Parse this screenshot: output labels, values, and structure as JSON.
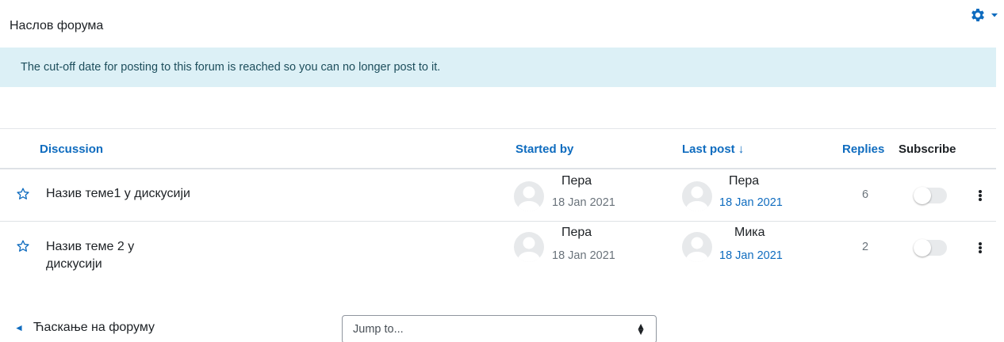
{
  "forum": {
    "title": "Наслов форума",
    "alert": "The cut-off date for posting to this forum is reached so you can no longer post to it."
  },
  "table": {
    "headers": {
      "discussion": "Discussion",
      "started_by": "Started by",
      "last_post": "Last post",
      "replies": "Replies",
      "subscribe": "Subscribe"
    },
    "sort_indicator": "↓",
    "rows": [
      {
        "topic": "Назив теме1 у дискусији",
        "started_by": "Пера",
        "started_date": "18 Jan 2021",
        "last_post_by": "Пера",
        "last_post_date": "18 Jan 2021",
        "replies": "6",
        "subscribed": false
      },
      {
        "topic": "Назив теме 2 у дискусији",
        "started_by": "Пера",
        "started_date": "18 Jan 2021",
        "last_post_by": "Мика",
        "last_post_date": "18 Jan 2021",
        "replies": "2",
        "subscribed": false
      }
    ]
  },
  "footer": {
    "prev_activity": "Ћаскање на форуму",
    "jump_placeholder": "Jump to..."
  },
  "icons": {
    "settings": "gear-icon",
    "favourite": "star-outline-icon",
    "actions": "kebab-icon"
  },
  "colors": {
    "accent": "#0f6cbf",
    "alert_bg": "#dcf0f6",
    "alert_text": "#1d4e5c",
    "muted": "#6a737b"
  }
}
